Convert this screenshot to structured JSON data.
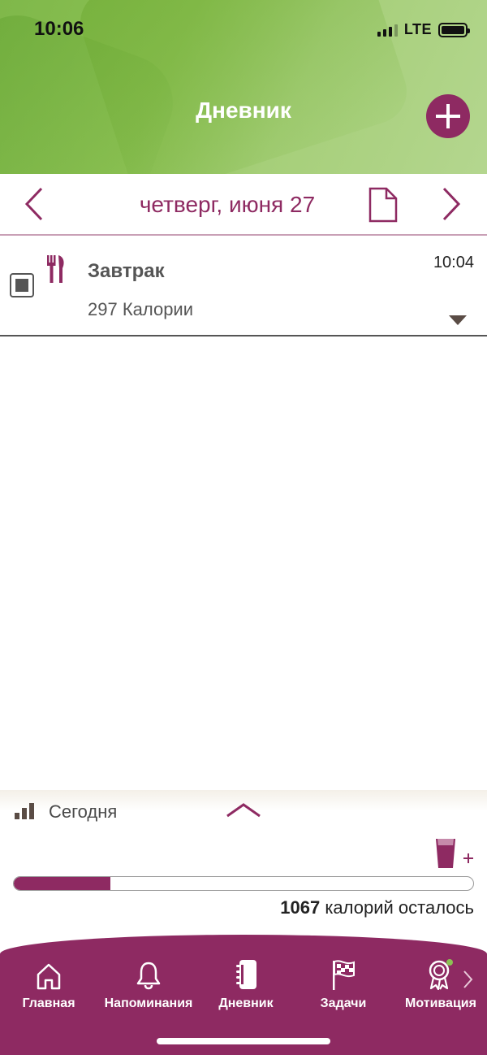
{
  "status_bar": {
    "time": "10:06",
    "network": "LTE"
  },
  "header": {
    "title": "Дневник",
    "add_icon": "plus-icon"
  },
  "date_nav": {
    "date": "четверг, июня 27",
    "prev_icon": "chevron-left-icon",
    "next_icon": "chevron-right-icon",
    "doc_icon": "document-icon"
  },
  "entry": {
    "title": "Завтрак",
    "calories": "297 Калории",
    "time": "10:04",
    "meal_icon": "cutlery-icon"
  },
  "today": {
    "label": "Сегодня",
    "remaining_value": "1067",
    "remaining_text": "калорий осталось",
    "progress": 0.21
  },
  "bottom_nav": {
    "items": [
      {
        "label": "Главная",
        "icon": "home-icon"
      },
      {
        "label": "Напоминания",
        "icon": "bell-icon"
      },
      {
        "label": "Дневник",
        "icon": "notebook-icon"
      },
      {
        "label": "Задачи",
        "icon": "flag-icon"
      },
      {
        "label": "Мотивация",
        "icon": "award-icon"
      }
    ]
  },
  "colors": {
    "brand": "#8e2a62",
    "header_green": "#8cc153",
    "text_dark": "#4a4a4a"
  }
}
